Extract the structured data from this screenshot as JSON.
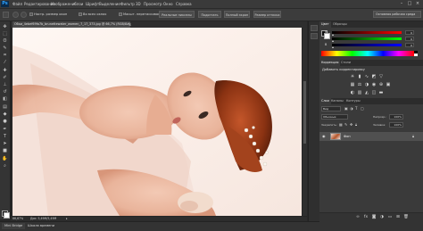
{
  "app": {
    "logo": "Ps"
  },
  "menubar": {
    "items": [
      "Файл",
      "Редактирование",
      "Изображение",
      "Слои",
      "Шрифт",
      "Выделение",
      "Фильтр",
      "3D",
      "Просмотр",
      "Окно",
      "Справка"
    ]
  },
  "options_bar": {
    "checkbox_label": "Настр. размер окон",
    "all_windows_label": "Во всех окнах",
    "scrubby_label": "Масшт. перетаскиванием",
    "btn_actual_pixels": "Реальные пикселы",
    "btn_fit_screen": "Подогнать",
    "btn_fill_screen": "Полный экран",
    "btn_print_size": "Размер оттиска",
    "workspace": "Основная рабочая среда"
  },
  "document": {
    "tab_title": "Обои_4ebef69fa7b_brunettewater_women_7_17_373.jpg @ 66,7% (RGB/8#)",
    "zoom": "66,67%",
    "doc_size": "Док: 5,49М/5,49М"
  },
  "bottom_bar": {
    "tab_mini_bridge": "Mini Bridge",
    "tab_timeline": "Шкала времени"
  },
  "color_panel": {
    "tab_color": "Цвет",
    "tab_swatches": "Образцы",
    "sliders": [
      {
        "label": "R",
        "value": "0",
        "position": 0.02
      },
      {
        "label": "G",
        "value": "0",
        "position": 0.02
      },
      {
        "label": "B",
        "value": "0",
        "position": 0.02
      }
    ]
  },
  "adjustments_panel": {
    "tab_adjustments": "Коррекция",
    "tab_styles": "Стили",
    "title": "Добавить корректировку"
  },
  "layers_panel": {
    "tab_layers": "Слои",
    "tab_channels": "Каналы",
    "tab_paths": "Контуры",
    "kind_label": "Вид",
    "blend_mode": "Обычные",
    "opacity_label": "Непрозр.:",
    "opacity": "100%",
    "lock_label": "Закрепить:",
    "fill_label": "Заливка:",
    "fill": "100%",
    "layers": [
      {
        "name": "Фон"
      }
    ]
  },
  "colors": {
    "accent": "#2fa3ff",
    "panel_bg": "#3a3a3a",
    "app_bg": "#282828"
  }
}
